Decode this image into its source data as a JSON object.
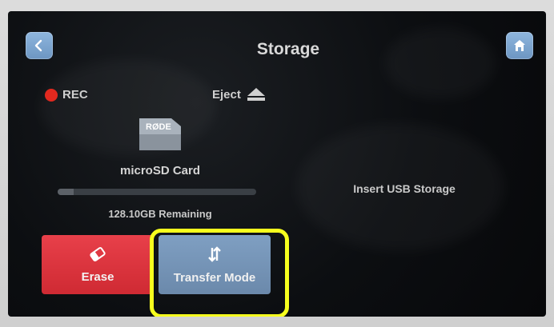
{
  "header": {
    "title": "Storage",
    "back_icon": "chevron-left-icon",
    "home_icon": "home-icon"
  },
  "status": {
    "rec_label": "REC",
    "rec_color": "#e2291f",
    "eject_label": "Eject"
  },
  "card": {
    "brand": "RØDE",
    "name": "microSD Card",
    "remaining": "128.10GB Remaining",
    "used_fraction": 0.08
  },
  "usb": {
    "message": "Insert USB Storage"
  },
  "actions": {
    "erase_label": "Erase",
    "transfer_label": "Transfer Mode"
  },
  "colors": {
    "accent_blue": "#7f9fc2",
    "erase_red": "#e8404a",
    "highlight": "#f6ff1e"
  }
}
